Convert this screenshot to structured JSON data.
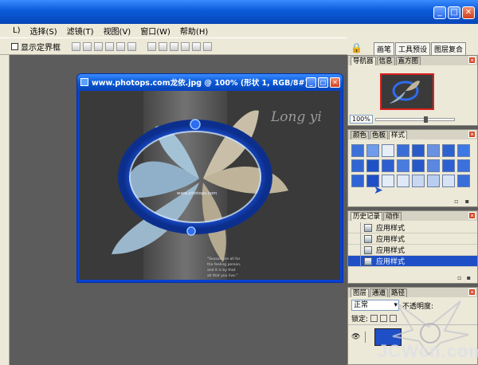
{
  "menu": [
    "L)",
    "选择(S)",
    "滤镜(T)",
    "视图(V)",
    "窗口(W)",
    "帮助(H)"
  ],
  "options": {
    "show_bounds_label": "显示定界框"
  },
  "well_tabs": [
    "画笔",
    "工具预设",
    "图层复合"
  ],
  "document": {
    "title": "www.photops.com龙依.jpg @ 100% (形状 1, RGB/8#)",
    "watermark": "Long yi",
    "caption_line1": "\"Season are all for",
    "caption_line2": "the feeling person,",
    "caption_line3": "and it is by that",
    "caption_line4": "all that you live.\"",
    "frame_text": "www.photops.com"
  },
  "navigator": {
    "tabs": [
      "导航器",
      "信息",
      "直方图"
    ],
    "zoom": "100%"
  },
  "styles": {
    "tabs": [
      "颜色",
      "色板",
      "样式"
    ]
  },
  "history": {
    "tabs": [
      "历史记录",
      "动作"
    ],
    "items": [
      "应用样式",
      "应用样式",
      "应用样式",
      "应用样式"
    ]
  },
  "layers": {
    "tabs": [
      "图层",
      "通道",
      "路径"
    ],
    "blend_mode": "正常",
    "opacity_label": "不透明度:",
    "lock_label": "锁定:"
  },
  "watermark": {
    "logo_text": "JCWcn.com"
  },
  "colors": {
    "titlebar": "#0a5ad8",
    "panel_bg": "#ece9d8",
    "workspace": "#5c5c5c",
    "selection": "#1f4fc6"
  }
}
